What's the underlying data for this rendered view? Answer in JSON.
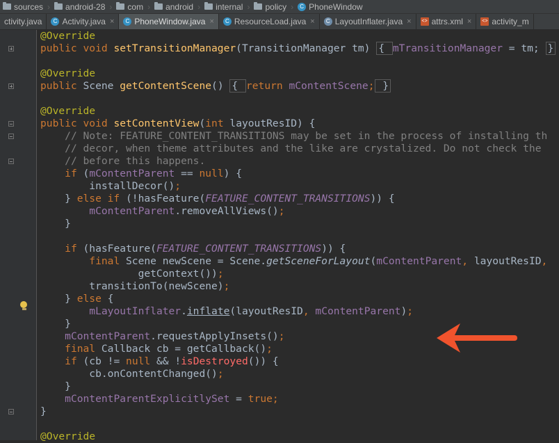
{
  "breadcrumb": [
    {
      "type": "folder",
      "label": "sources"
    },
    {
      "type": "folder",
      "label": "android-28"
    },
    {
      "type": "folder",
      "label": "com"
    },
    {
      "type": "folder",
      "label": "android"
    },
    {
      "type": "folder",
      "label": "internal"
    },
    {
      "type": "folder",
      "label": "policy"
    },
    {
      "type": "class",
      "label": "PhoneWindow"
    }
  ],
  "tabs": [
    {
      "label": "ctivity.java",
      "icon": "none",
      "active": false
    },
    {
      "label": "Activity.java",
      "icon": "class-icon",
      "active": false
    },
    {
      "label": "PhoneWindow.java",
      "icon": "class-icon",
      "active": true
    },
    {
      "label": "ResourceLoad.java",
      "icon": "class-icon",
      "active": false
    },
    {
      "label": "LayoutInflater.java",
      "icon": "abstract-class-icon",
      "active": false
    },
    {
      "label": "attrs.xml",
      "icon": "xml-icon",
      "active": false
    },
    {
      "label": "activity_m",
      "icon": "xml-icon",
      "active": false
    }
  ],
  "tab_close_glyph": "×",
  "code_lines": [
    [
      [
        "an",
        "@Override"
      ]
    ],
    [
      [
        "kw",
        "public void "
      ],
      [
        "fn",
        "setTransitionManager"
      ],
      [
        "p",
        "(TransitionManager tm) "
      ],
      [
        "box",
        "{ "
      ],
      [
        "fld",
        "mTransitionManager"
      ],
      [
        "p",
        " = tm; "
      ],
      [
        "box",
        "}"
      ]
    ],
    [],
    [
      [
        "an",
        "@Override"
      ]
    ],
    [
      [
        "kw",
        "public "
      ],
      [
        "p",
        "Scene "
      ],
      [
        "fn",
        "getContentScene"
      ],
      [
        "p",
        "() "
      ],
      [
        "box",
        "{ "
      ],
      [
        "kw",
        "return "
      ],
      [
        "fld",
        "mContentScene"
      ],
      [
        "kw",
        ";"
      ],
      [
        "box",
        " }"
      ]
    ],
    [],
    [
      [
        "an",
        "@Override"
      ]
    ],
    [
      [
        "kw",
        "public void "
      ],
      [
        "fn",
        "setContentView"
      ],
      [
        "p",
        "("
      ],
      [
        "kw",
        "int "
      ],
      [
        "p",
        "layoutResID) {"
      ]
    ],
    [
      [
        "p",
        "    "
      ],
      [
        "cm",
        "// Note: FEATURE_CONTENT_TRANSITIONS may be set in the process of installing th"
      ]
    ],
    [
      [
        "p",
        "    "
      ],
      [
        "cm",
        "// decor, when theme attributes and the like are crystalized. Do not check the"
      ]
    ],
    [
      [
        "p",
        "    "
      ],
      [
        "cm",
        "// before this happens."
      ]
    ],
    [
      [
        "p",
        "    "
      ],
      [
        "kw",
        "if "
      ],
      [
        "p",
        "("
      ],
      [
        "fld",
        "mContentParent"
      ],
      [
        "p",
        " == "
      ],
      [
        "kw",
        "null"
      ],
      [
        "p",
        ") {"
      ]
    ],
    [
      [
        "p",
        "        installDecor()"
      ],
      [
        "kw",
        ";"
      ]
    ],
    [
      [
        "p",
        "    } "
      ],
      [
        "kw",
        "else if "
      ],
      [
        "p",
        "(!hasFeature("
      ],
      [
        "sfld",
        "FEATURE_CONTENT_TRANSITIONS"
      ],
      [
        "p",
        ")) {"
      ]
    ],
    [
      [
        "p",
        "        "
      ],
      [
        "fld",
        "mContentParent"
      ],
      [
        "p",
        ".removeAllViews()"
      ],
      [
        "kw",
        ";"
      ]
    ],
    [
      [
        "p",
        "    }"
      ]
    ],
    [],
    [
      [
        "p",
        "    "
      ],
      [
        "kw",
        "if "
      ],
      [
        "p",
        "(hasFeature("
      ],
      [
        "sfld",
        "FEATURE_CONTENT_TRANSITIONS"
      ],
      [
        "p",
        ")) {"
      ]
    ],
    [
      [
        "p",
        "        "
      ],
      [
        "kw",
        "final "
      ],
      [
        "p",
        "Scene newScene = Scene."
      ],
      [
        "it",
        "getSceneForLayout"
      ],
      [
        "p",
        "("
      ],
      [
        "fld",
        "mContentParent"
      ],
      [
        "kw",
        ", "
      ],
      [
        "p",
        "layoutResID"
      ],
      [
        "kw",
        ","
      ]
    ],
    [
      [
        "p",
        "                getContext())"
      ],
      [
        "kw",
        ";"
      ]
    ],
    [
      [
        "p",
        "        transitionTo(newScene)"
      ],
      [
        "kw",
        ";"
      ]
    ],
    [
      [
        "p",
        "    } "
      ],
      [
        "kw",
        "else "
      ],
      [
        "p",
        "{"
      ]
    ],
    [
      [
        "p",
        "        "
      ],
      [
        "fld",
        "mLayoutInflater"
      ],
      [
        "p",
        "."
      ],
      [
        "ul",
        "inflate"
      ],
      [
        "p",
        "(layoutResID"
      ],
      [
        "kw",
        ", "
      ],
      [
        "fld",
        "mContentParent"
      ],
      [
        "p",
        ")"
      ],
      [
        "kw",
        ";"
      ]
    ],
    [
      [
        "p",
        "    }"
      ]
    ],
    [
      [
        "p",
        "    "
      ],
      [
        "fld",
        "mContentParent"
      ],
      [
        "p",
        ".requestApplyInsets()"
      ],
      [
        "kw",
        ";"
      ]
    ],
    [
      [
        "p",
        "    "
      ],
      [
        "kw",
        "final "
      ],
      [
        "p",
        "Callback cb = getCallback()"
      ],
      [
        "kw",
        ";"
      ]
    ],
    [
      [
        "p",
        "    "
      ],
      [
        "kw",
        "if "
      ],
      [
        "p",
        "(cb != "
      ],
      [
        "kw",
        "null "
      ],
      [
        "p",
        "&& !"
      ],
      [
        "red",
        "isDestroyed"
      ],
      [
        "p",
        "()) {"
      ]
    ],
    [
      [
        "p",
        "        cb.onContentChanged()"
      ],
      [
        "kw",
        ";"
      ]
    ],
    [
      [
        "p",
        "    }"
      ]
    ],
    [
      [
        "p",
        "    "
      ],
      [
        "fld",
        "mContentParentExplicitlySet"
      ],
      [
        "p",
        " = "
      ],
      [
        "kw",
        "true;"
      ]
    ],
    [
      [
        "p",
        "}"
      ]
    ],
    [],
    [
      [
        "an",
        "@Override"
      ]
    ]
  ],
  "fold_markers": [
    {
      "line": 1,
      "kind": "plus"
    },
    {
      "line": 4,
      "kind": "plus"
    },
    {
      "line": 7,
      "kind": "minus"
    },
    {
      "line": 8,
      "kind": "minus"
    },
    {
      "line": 10,
      "kind": "minus"
    },
    {
      "line": 30,
      "kind": "minus"
    }
  ],
  "colors": {
    "keyword": "#cc7832",
    "annotation": "#bbb529",
    "method": "#ffc66d",
    "field": "#9876aa",
    "comment": "#808080",
    "error": "#ff6b68",
    "arrow": "#f0532d",
    "background": "#2b2b2b"
  },
  "annotation_arrow": {
    "points_to_line": 22,
    "color": "#f0532d"
  }
}
